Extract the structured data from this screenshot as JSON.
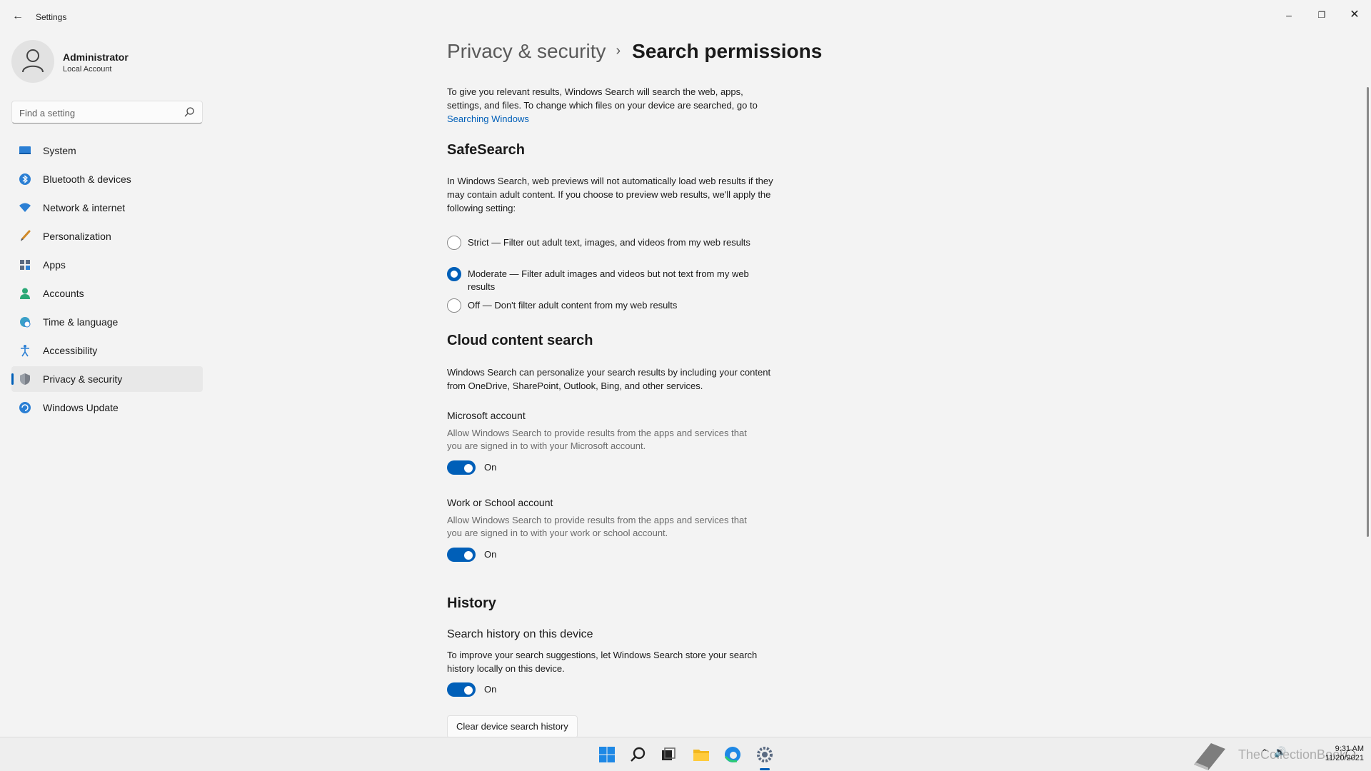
{
  "window": {
    "title": "Settings",
    "back_icon": "back-arrow-icon",
    "controls": {
      "minimize": "–",
      "maximize": "❐",
      "close": "✕"
    }
  },
  "profile": {
    "name": "Administrator",
    "account_type": "Local Account"
  },
  "search": {
    "placeholder": "Find a setting"
  },
  "sidebar": {
    "items": [
      {
        "label": "System",
        "icon": "monitor-icon"
      },
      {
        "label": "Bluetooth & devices",
        "icon": "bluetooth-icon"
      },
      {
        "label": "Network & internet",
        "icon": "wifi-icon"
      },
      {
        "label": "Personalization",
        "icon": "brush-icon"
      },
      {
        "label": "Apps",
        "icon": "apps-icon"
      },
      {
        "label": "Accounts",
        "icon": "person-icon"
      },
      {
        "label": "Time & language",
        "icon": "globe-clock-icon"
      },
      {
        "label": "Accessibility",
        "icon": "accessibility-icon"
      },
      {
        "label": "Privacy & security",
        "icon": "shield-icon",
        "active": true
      },
      {
        "label": "Windows Update",
        "icon": "update-icon"
      }
    ]
  },
  "breadcrumb": {
    "parent": "Privacy & security",
    "separator": "›",
    "current": "Search permissions"
  },
  "intro": {
    "text": "To give you relevant results, Windows Search will search the web, apps, settings, and files. To change which files on your device are searched, go to ",
    "link": "Searching Windows"
  },
  "safesearch": {
    "heading": "SafeSearch",
    "description": "In Windows Search, web previews will not automatically load web results if they may contain adult content. If you choose to preview web results, we'll apply the following setting:",
    "options": [
      {
        "label": "Strict — Filter out adult text, images, and videos from my web results",
        "checked": false
      },
      {
        "label": "Moderate — Filter adult images and videos but not text from my web results",
        "checked": true
      },
      {
        "label": "Off — Don't filter adult content from my web results",
        "checked": false
      }
    ]
  },
  "cloud": {
    "heading": "Cloud content search",
    "description": "Windows Search can personalize your search results by including your content from OneDrive, SharePoint, Outlook, Bing, and other services.",
    "microsoft": {
      "title": "Microsoft account",
      "description": "Allow Windows Search to provide results from the apps and services that you are signed in to with your Microsoft account.",
      "toggle_label": "On",
      "on": true
    },
    "work": {
      "title": "Work or School account",
      "description": "Allow Windows Search to provide results from the apps and services that you are signed in to with your work or school account.",
      "toggle_label": "On",
      "on": true
    }
  },
  "history": {
    "heading": "History",
    "subheading": "Search history on this device",
    "description": "To improve your search suggestions, let Windows Search store your search history locally on this device.",
    "toggle_label": "On",
    "on": true,
    "clear_button": "Clear device search history"
  },
  "taskbar": {
    "apps": [
      "windows-start-icon",
      "search-icon",
      "task-view-icon",
      "file-explorer-icon",
      "edge-icon",
      "settings-icon"
    ],
    "time": "9:31 AM",
    "date": "11/20/2021",
    "watermark": "TheCollectionBook"
  },
  "colors": {
    "accent": "#005fb8",
    "background": "#f3f3f3"
  }
}
